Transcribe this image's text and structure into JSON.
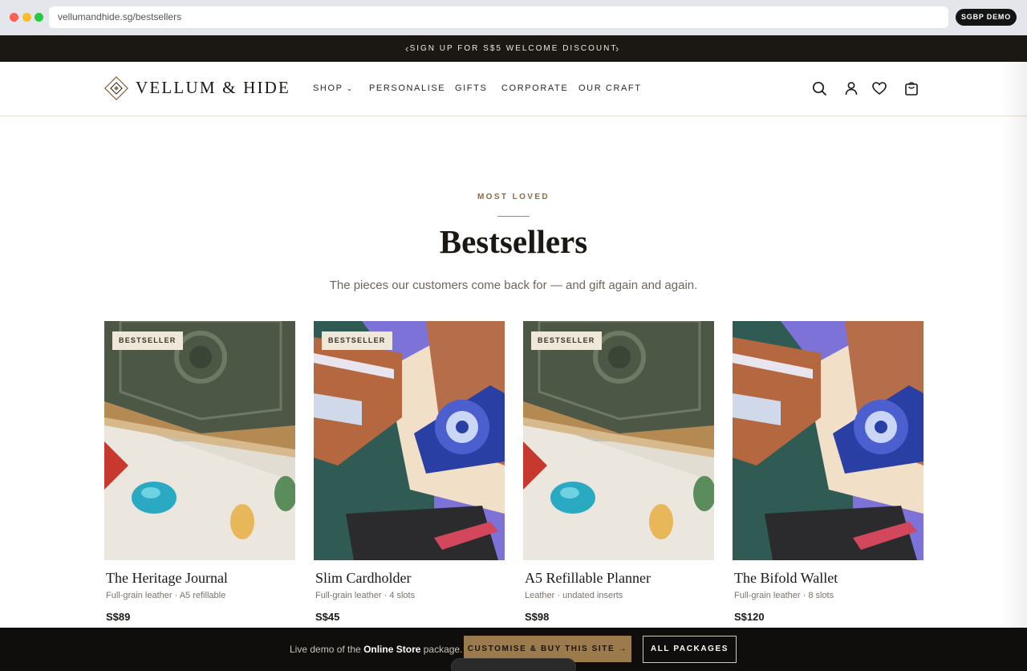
{
  "browser": {
    "url": "vellumandhide.sg/bestsellers",
    "badge": "SGBP DEMO"
  },
  "announcement": {
    "text": "SIGN UP FOR S$5 WELCOME DISCOUNT",
    "prev_arrow": "‹",
    "next_arrow": "›"
  },
  "header": {
    "brand": "VELLUM & HIDE",
    "nav": [
      {
        "label": "SHOP",
        "has_dropdown": true
      },
      {
        "label": "PERSONALISE"
      },
      {
        "label": "GIFTS"
      },
      {
        "label": "CORPORATE"
      },
      {
        "label": "OUR CRAFT"
      }
    ],
    "dropdown_glyph": "⌄",
    "icons": [
      "search-icon",
      "account-icon",
      "heart-icon",
      "bag-icon"
    ]
  },
  "hero": {
    "eyebrow": "MOST LOVED",
    "title": "Bestsellers",
    "subtitle": "The pieces our customers come back for — and gift again and again."
  },
  "products": [
    {
      "name": "The Heritage Journal",
      "desc": "Full-grain leather · A5 refillable",
      "price": "S$89",
      "badge": "BESTSELLER",
      "image": "journal"
    },
    {
      "name": "Slim Cardholder",
      "desc": "Full-grain leather · 4 slots",
      "price": "S$45",
      "badge": "BESTSELLER",
      "image": "wallet"
    },
    {
      "name": "A5 Refillable Planner",
      "desc": "Leather · undated inserts",
      "price": "S$98",
      "badge": "BESTSELLER",
      "image": "journal"
    },
    {
      "name": "The Bifold Wallet",
      "desc": "Full-grain leather · 8 slots",
      "price": "S$120",
      "badge": "",
      "image": "wallet"
    }
  ],
  "demo_bar": {
    "prefix": "Live demo of the ",
    "package": "Online Store",
    "suffix": " package.",
    "buy_label": "CUSTOMISE & BUY THIS SITE →",
    "packages_label": "ALL PACKAGES"
  },
  "colors": {
    "accent": "#9b7a4b",
    "dark": "#1b1814",
    "eyebrow": "#8c6b3f"
  }
}
